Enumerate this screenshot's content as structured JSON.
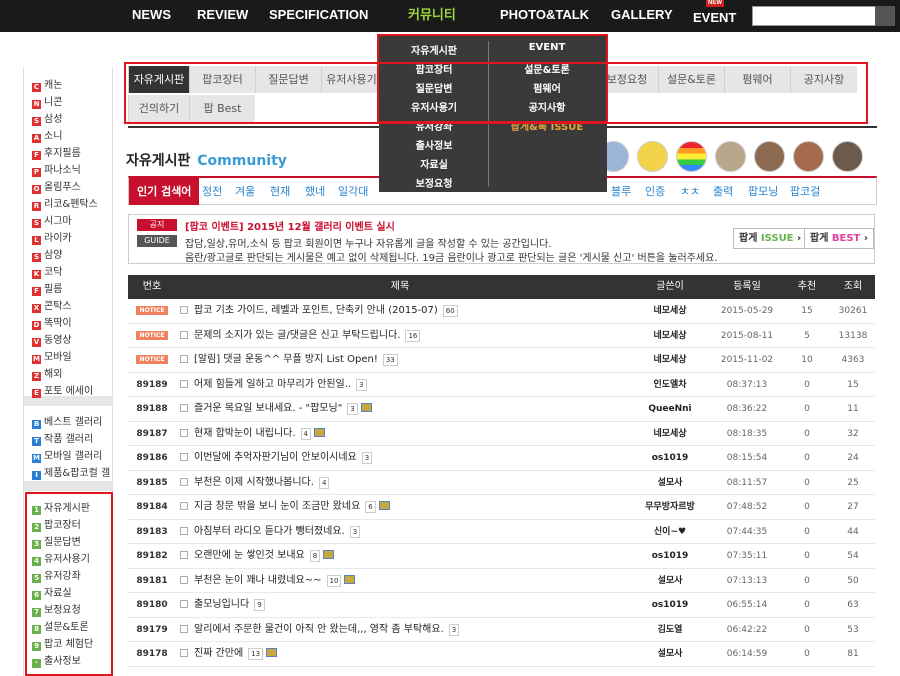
{
  "nav": {
    "items": [
      "NEWS",
      "REVIEW",
      "SPECIFICATION",
      "커뮤니티",
      "PHOTO&TALK",
      "GALLERY",
      "EVENT"
    ],
    "active_index": 3,
    "new_badge": "NEW"
  },
  "sidebar": {
    "brands": [
      {
        "icon": "C",
        "label": "캐논",
        "color": "#e03030"
      },
      {
        "icon": "N",
        "label": "니콘",
        "color": "#e03030"
      },
      {
        "icon": "S",
        "label": "삼성",
        "color": "#e03030"
      },
      {
        "icon": "A",
        "label": "소니",
        "color": "#e03030"
      },
      {
        "icon": "F",
        "label": "후지필름",
        "color": "#e03030"
      },
      {
        "icon": "P",
        "label": "파나소닉",
        "color": "#e03030"
      },
      {
        "icon": "O",
        "label": "올림푸스",
        "color": "#e03030"
      },
      {
        "icon": "R",
        "label": "리코&펜탁스",
        "color": "#e03030"
      },
      {
        "icon": "S",
        "label": "시그마",
        "color": "#e03030"
      },
      {
        "icon": "L",
        "label": "라이카",
        "color": "#e03030"
      },
      {
        "icon": "S",
        "label": "삼양",
        "color": "#e03030"
      },
      {
        "icon": "K",
        "label": "코닥",
        "color": "#e03030"
      },
      {
        "icon": "F",
        "label": "필름",
        "color": "#e03030"
      },
      {
        "icon": "X",
        "label": "콘탁스",
        "color": "#e03030"
      },
      {
        "icon": "D",
        "label": "똑딱이",
        "color": "#e03030"
      },
      {
        "icon": "V",
        "label": "동영상",
        "color": "#e03030"
      },
      {
        "icon": "M",
        "label": "모바일",
        "color": "#e03030"
      },
      {
        "icon": "Z",
        "label": "해외",
        "color": "#e03030"
      },
      {
        "icon": "E",
        "label": "포토 에세이",
        "color": "#e03030"
      }
    ],
    "galleries": [
      {
        "icon": "B",
        "label": "베스트 갤러리",
        "color": "#2a7fd4"
      },
      {
        "icon": "T",
        "label": "작품 갤러리",
        "color": "#2a7fd4"
      },
      {
        "icon": "M",
        "label": "모바일 갤러리",
        "color": "#2a7fd4"
      },
      {
        "icon": "I",
        "label": "제품&팝코컬 갤",
        "color": "#2a7fd4"
      }
    ],
    "community": [
      {
        "icon": "1",
        "label": "자유게시판",
        "color": "#6ab04c"
      },
      {
        "icon": "2",
        "label": "팝코장터",
        "color": "#6ab04c"
      },
      {
        "icon": "3",
        "label": "질문답변",
        "color": "#6ab04c"
      },
      {
        "icon": "4",
        "label": "유저사용기",
        "color": "#6ab04c"
      },
      {
        "icon": "5",
        "label": "유저강좌",
        "color": "#6ab04c"
      },
      {
        "icon": "6",
        "label": "자료실",
        "color": "#6ab04c"
      },
      {
        "icon": "7",
        "label": "보정요청",
        "color": "#6ab04c"
      },
      {
        "icon": "8",
        "label": "설문&토론",
        "color": "#6ab04c"
      },
      {
        "icon": "9",
        "label": "팝코 체험단",
        "color": "#6ab04c"
      },
      {
        "icon": "·",
        "label": "출사정보",
        "color": "#6ab04c"
      }
    ]
  },
  "board_tabs": [
    "자유게시판",
    "팝코장터",
    "질문답변",
    "유저사용기",
    "보정요청",
    "설문&토론",
    "펌웨어",
    "공지사항",
    "건의하기",
    "팝 Best"
  ],
  "dropdown": {
    "left": [
      "자유게시판",
      "팝코장터",
      "질문답변",
      "유저사용기",
      "유저강좌",
      "출사정보",
      "자료실",
      "보정요청"
    ],
    "right": [
      "EVENT",
      "설문&토론",
      "펌웨어",
      "공지사항",
      "팝게&톡 ISSUE"
    ]
  },
  "board": {
    "title": "자유게시판",
    "subtitle": "Community"
  },
  "filters": [
    "인기 검색어",
    "정전",
    "겨울",
    "현재",
    "했네",
    "일각대",
    "블루",
    "인증",
    "ㅊㅊ",
    "출력",
    "팝모닝",
    "팝코걸"
  ],
  "notices": {
    "tag1": "공지",
    "tag2": "GUIDE",
    "line1": "[팝코 이벤트] 2015년 12월 갤러리 이벤트 실시",
    "line2": "잡담,일상,유머,소식 등 팝코 회원이면 누구나 자유롭게 글을 작성할 수 있는 공간입니다.",
    "line3": "음란/광고글로 판단되는 게시물은 예고 없이 삭제됩니다. 19금 음란이나 광고로 판단되는 글은 '게시물 신고' 버튼을 눌러주세요.",
    "btn1a": "팝게",
    "btn1b": "ISSUE",
    "btn2a": "팝게",
    "btn2b": "BEST"
  },
  "table": {
    "headers": [
      "번호",
      "제목",
      "글쓴이",
      "등록일",
      "추천",
      "조회"
    ],
    "rows": [
      {
        "num": "NOTICE",
        "subject": "팝코 기초 가이드, 레벨과 포인트, 단축키 안내 (2015-07)",
        "count": "60",
        "img": false,
        "author": "네모세상",
        "date": "2015-05-29",
        "rec": "15",
        "views": "30261"
      },
      {
        "num": "NOTICE",
        "subject": "문제의 소지가 있는 글/댓글은 신고 부탁드립니다.",
        "count": "16",
        "img": false,
        "author": "네모세상",
        "date": "2015-08-11",
        "rec": "5",
        "views": "13138"
      },
      {
        "num": "NOTICE",
        "subject": "[알림] 댓글 운동^^ 무플 방지 List Open!",
        "count": "33",
        "img": false,
        "author": "네모세상",
        "date": "2015-11-02",
        "rec": "10",
        "views": "4363"
      },
      {
        "num": "89189",
        "subject": "어제 힘들게 일하고 마무리가 안된일..",
        "count": "3",
        "img": false,
        "author": "인도엘차",
        "date": "08:37:13",
        "rec": "0",
        "views": "15"
      },
      {
        "num": "89188",
        "subject": "즐거운 목요일 보내세요. - \"팝모닝\"",
        "count": "3",
        "img": true,
        "author": "QueeNni",
        "date": "08:36:22",
        "rec": "0",
        "views": "11"
      },
      {
        "num": "89187",
        "subject": "현재 합박눈이 내립니다.",
        "count": "4",
        "img": true,
        "author": "네모세상",
        "date": "08:18:35",
        "rec": "0",
        "views": "32"
      },
      {
        "num": "89186",
        "subject": "이번달에 추억자판기님이 안보이시네요",
        "count": "3",
        "img": false,
        "author": "os1019",
        "date": "08:15:54",
        "rec": "0",
        "views": "24"
      },
      {
        "num": "89185",
        "subject": "부천은 이제 시작했나봅니다.",
        "count": "4",
        "img": false,
        "author": "설모사",
        "date": "08:11:57",
        "rec": "0",
        "views": "25"
      },
      {
        "num": "89184",
        "subject": "지금 창문 밖을 보니 눈이 조금만 왔네요",
        "count": "6",
        "img": true,
        "author": "무무방자르방",
        "date": "07:48:52",
        "rec": "0",
        "views": "27"
      },
      {
        "num": "89183",
        "subject": "아침부터 라디오 듣다가 뺑터졌네요.",
        "count": "3",
        "img": false,
        "author": "신이~♥",
        "date": "07:44:35",
        "rec": "0",
        "views": "44"
      },
      {
        "num": "89182",
        "subject": "오랜만에 눈 쌓인것 보내요",
        "count": "8",
        "img": true,
        "author": "os1019",
        "date": "07:35:11",
        "rec": "0",
        "views": "54"
      },
      {
        "num": "89181",
        "subject": "부천은 눈이 꽤나 내렸네요~~",
        "count": "10",
        "img": true,
        "author": "설모사",
        "date": "07:13:13",
        "rec": "0",
        "views": "50"
      },
      {
        "num": "89180",
        "subject": "출모닝입니다",
        "count": "9",
        "img": false,
        "author": "os1019",
        "date": "06:55:14",
        "rec": "0",
        "views": "63"
      },
      {
        "num": "89179",
        "subject": "알리에서 주문한 물건이 아직 안 왔는데,,, 영작 좀 부탁해요.",
        "count": "3",
        "img": false,
        "author": "김도열",
        "date": "06:42:22",
        "rec": "0",
        "views": "53"
      },
      {
        "num": "89178",
        "subject": "진짜 간만에",
        "count": "13",
        "img": true,
        "author": "설모사",
        "date": "06:14:59",
        "rec": "0",
        "views": "81"
      }
    ]
  },
  "colors": {
    "accent": "#c8102e",
    "nav_active": "#9ed53d",
    "highlight_box": "#e0161e"
  }
}
